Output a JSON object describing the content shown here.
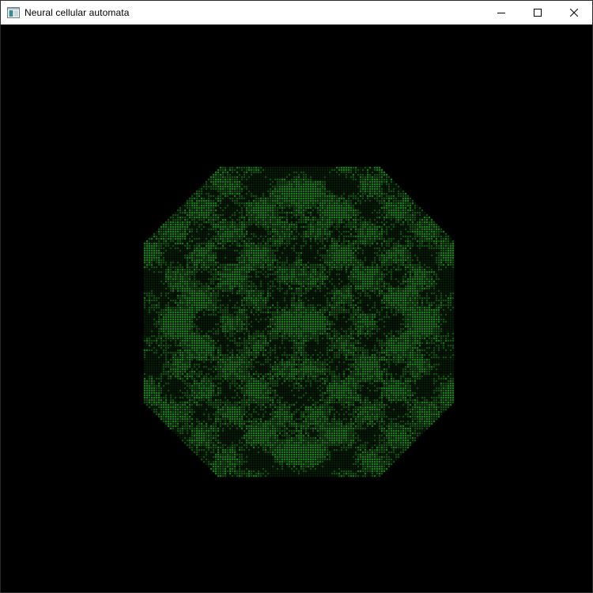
{
  "window": {
    "title": "Neural cellular automata"
  },
  "controls": [
    {
      "name": "minimize-button",
      "icon": "minimize-icon"
    },
    {
      "name": "maximize-button",
      "icon": "maximize-icon"
    },
    {
      "name": "close-button",
      "icon": "close-icon"
    }
  ],
  "colors": {
    "background": "#000000",
    "cell_bright": "#1ea81e",
    "cell_mid": "#137013",
    "cell_dark": "#062a06",
    "titlebar": "#ffffff"
  }
}
